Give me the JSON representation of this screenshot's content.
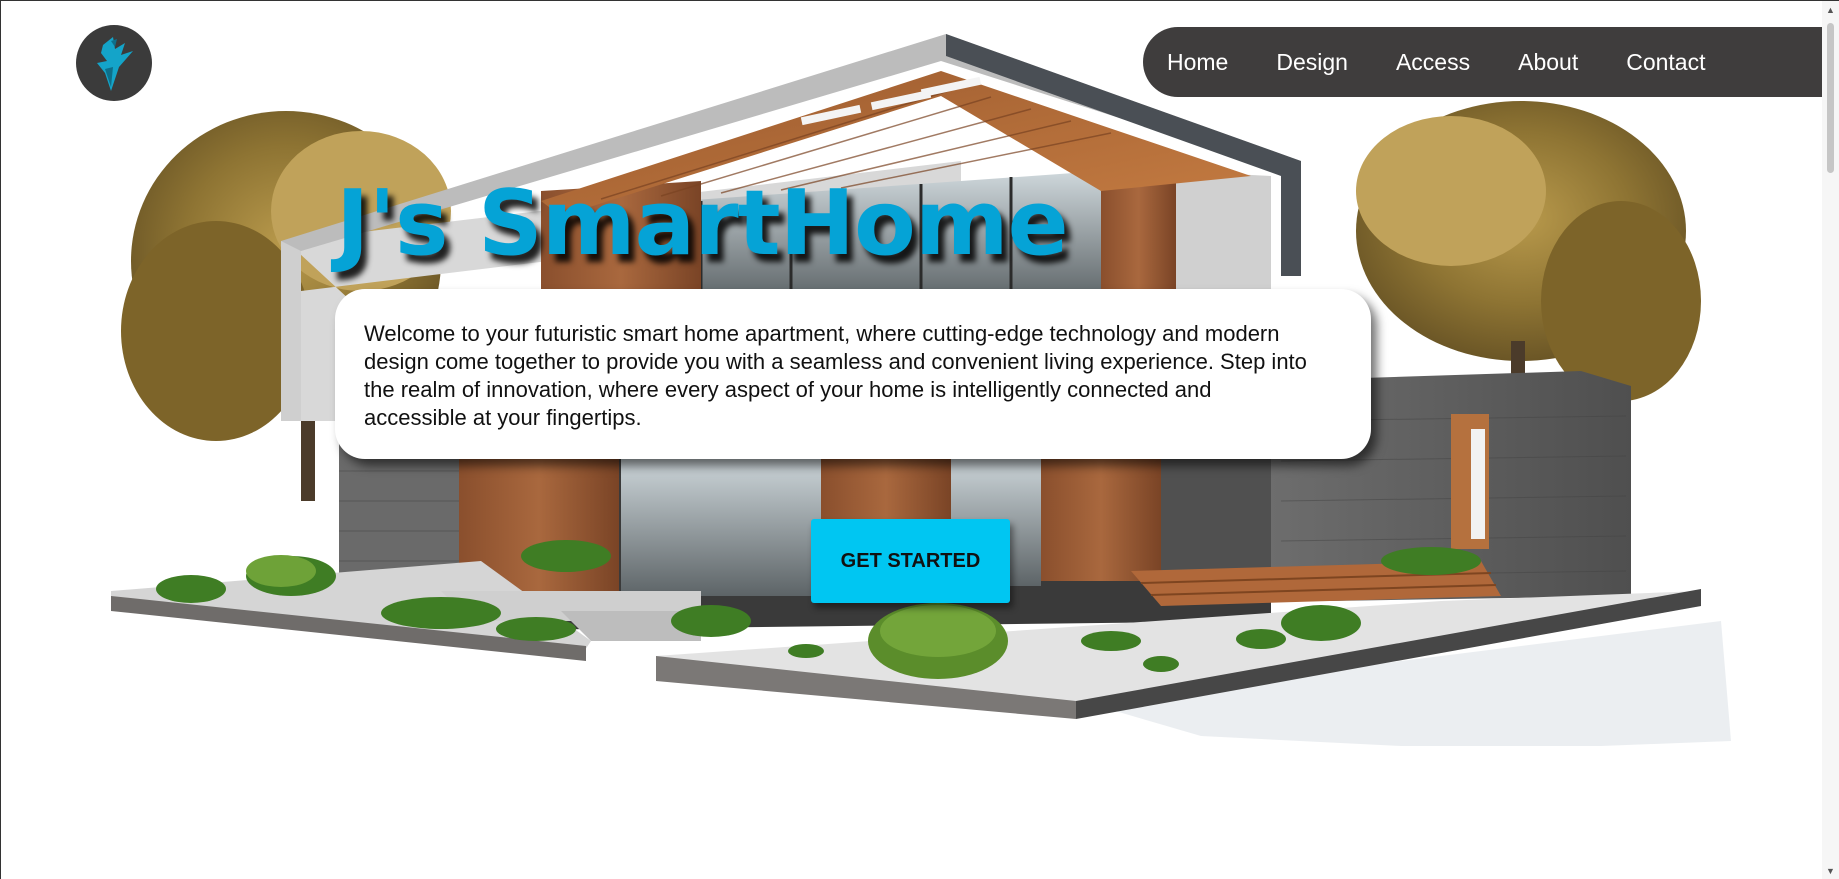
{
  "brand": {
    "logo_icon": "bird-logo-icon",
    "accent_color": "#05a3d6"
  },
  "nav": {
    "items": [
      {
        "label": "Home"
      },
      {
        "label": "Design"
      },
      {
        "label": "Access"
      },
      {
        "label": "About"
      },
      {
        "label": "Contact"
      }
    ]
  },
  "hero": {
    "title": "J's SmartHome",
    "description": "Welcome to your futuristic smart home apartment, where cutting-edge technology and modern design come together to provide you with a seamless and convenient living experience. Step into the realm of innovation, where every aspect of your home is intelligently connected and accessible at your fingertips.",
    "cta_label": "GET STARTED",
    "cta_color": "#00c6f2"
  },
  "colors": {
    "nav_background": "#3f3d3d",
    "logo_background": "#3b3b3b"
  }
}
